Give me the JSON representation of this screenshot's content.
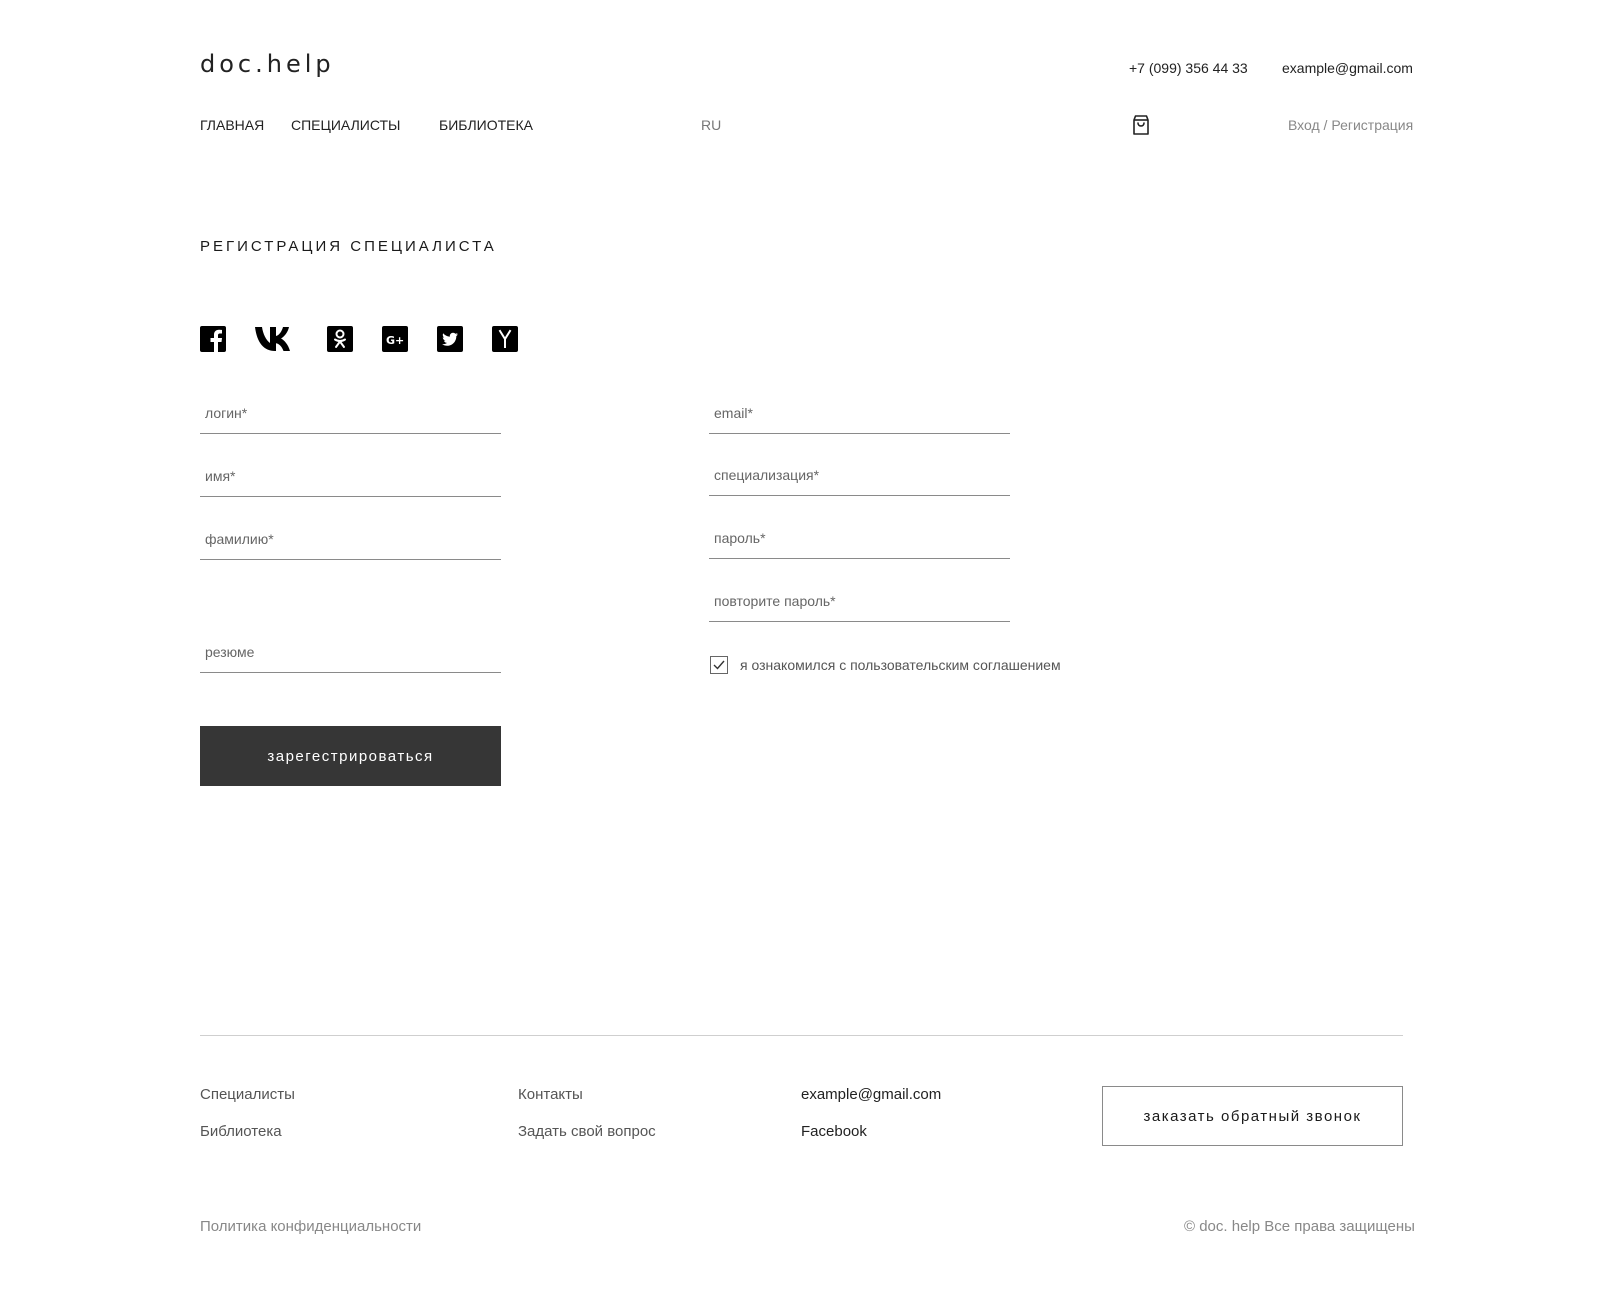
{
  "header": {
    "logo": "doc.help",
    "phone": "+7 (099) 356 44 33",
    "email": "example@gmail.com",
    "nav": [
      "ГЛАВНАЯ",
      "СПЕЦИАЛИСТЫ",
      "БИБЛИОТЕКА"
    ],
    "lang": "RU",
    "auth": "Вход / Регистрация",
    "cart_icon": "cart-icon"
  },
  "page": {
    "title": "РЕГИСТРАЦИЯ СПЕЦИАЛИСТА"
  },
  "social": [
    "facebook-icon",
    "vk-icon",
    "odnoklassniki-icon",
    "google-plus-icon",
    "twitter-icon",
    "yandex-icon"
  ],
  "form": {
    "login": {
      "placeholder": "логин*",
      "value": ""
    },
    "name": {
      "placeholder": "имя*",
      "value": ""
    },
    "surname": {
      "placeholder": "фамилию*",
      "value": ""
    },
    "resume": {
      "placeholder": "резюме",
      "value": ""
    },
    "email": {
      "placeholder": "email*",
      "value": ""
    },
    "specialization": {
      "placeholder": "специализация*",
      "value": ""
    },
    "password": {
      "placeholder": "пароль*",
      "value": ""
    },
    "password_repeat": {
      "placeholder": "повторите пароль*",
      "value": ""
    },
    "agreement": {
      "label": "я ознакомился с пользовательским соглашением",
      "checked": true
    },
    "submit_label": "зарегестрироваться"
  },
  "footer": {
    "col1": [
      "Специалисты",
      "Библиотека"
    ],
    "col2": [
      "Контакты",
      "Задать свой вопрос"
    ],
    "col3": [
      "example@gmail.com",
      "Facebook"
    ],
    "callback_label": "заказать обратный звонок",
    "policy": "Политика конфиденциальности",
    "copyright": "© doc. help Все права защищены"
  }
}
